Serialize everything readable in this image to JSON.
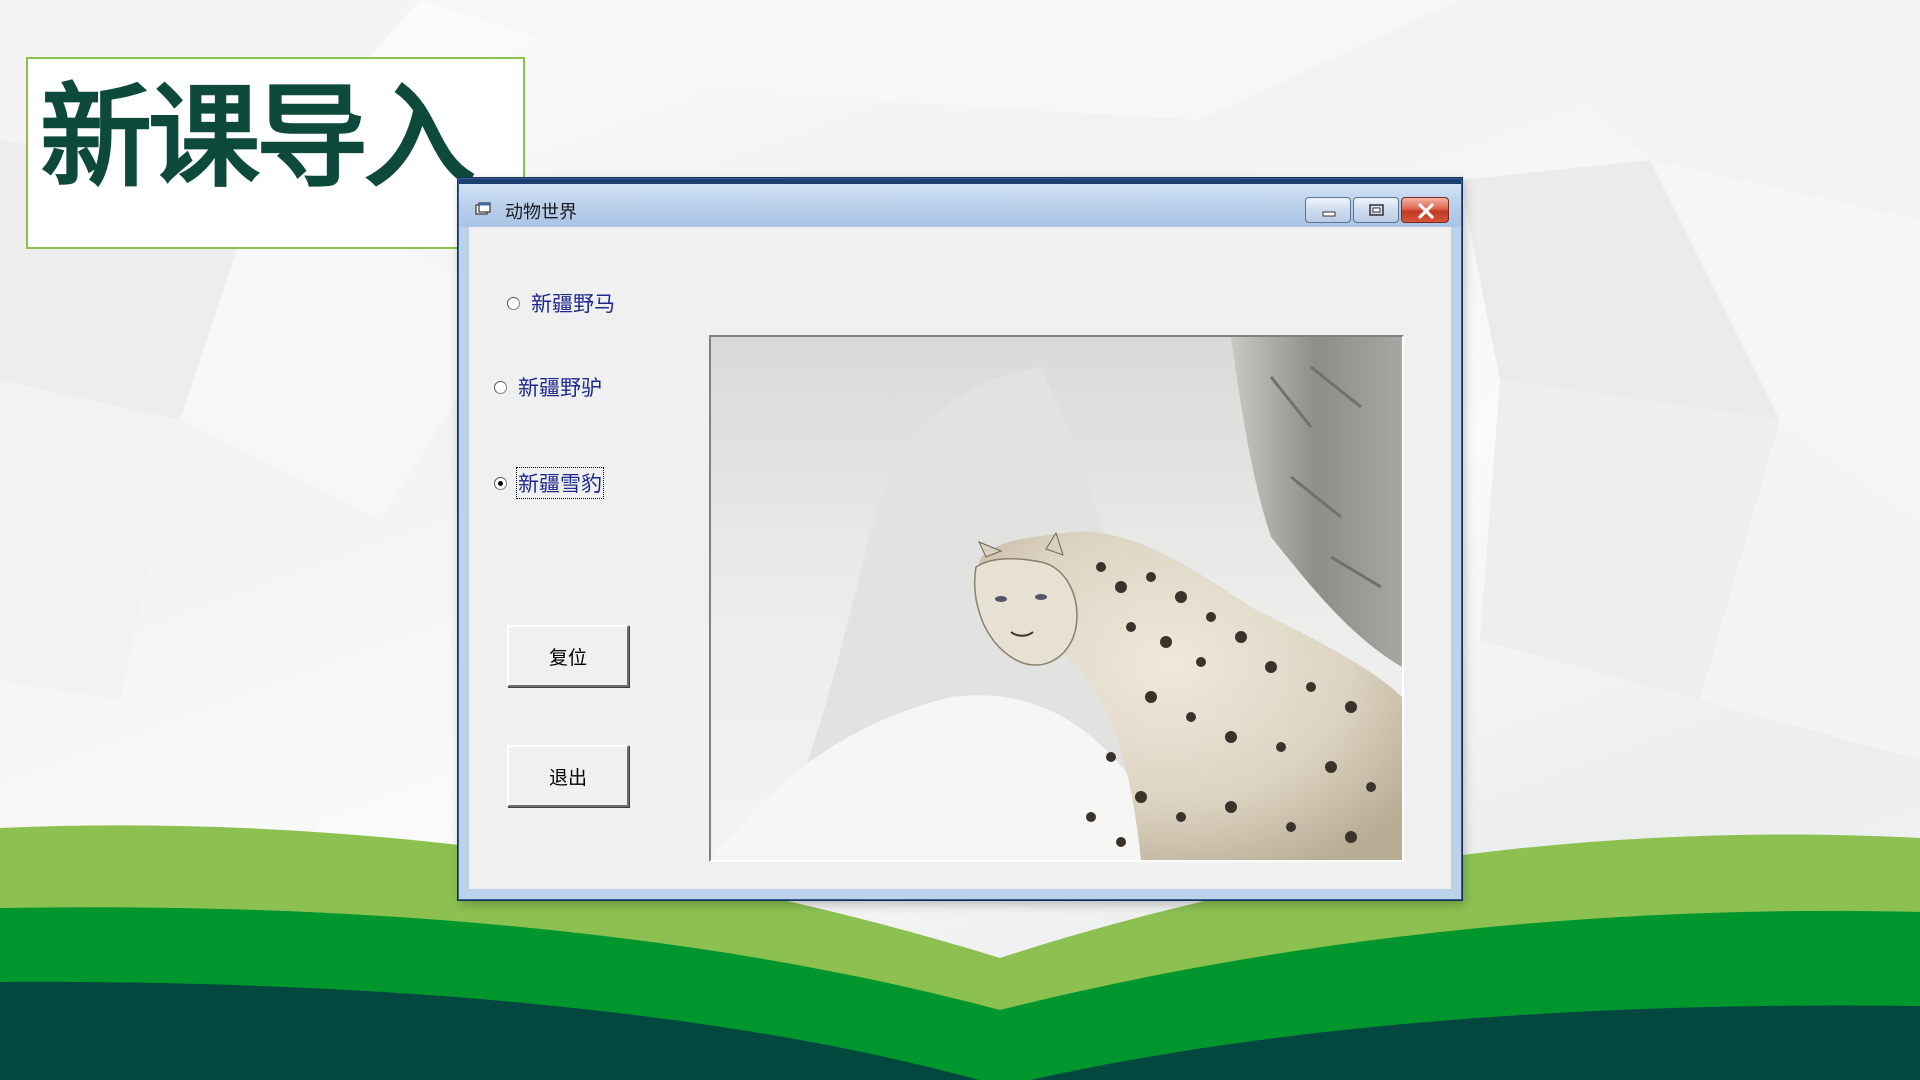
{
  "slide": {
    "title": "新课导入",
    "colors": {
      "title": "#0e4a3c",
      "frame": "#8cc152",
      "band_light": "#8cc152",
      "band_mid": "#00962e",
      "band_dark": "#02483e"
    }
  },
  "window": {
    "title": "动物世界",
    "icons": {
      "app": "form-icon",
      "minimize": "minimize-icon",
      "maximize": "maximize-icon",
      "close": "close-icon"
    }
  },
  "options": [
    {
      "label": "新疆野马",
      "checked": false
    },
    {
      "label": "新疆野驴",
      "checked": false
    },
    {
      "label": "新疆雪豹",
      "checked": true
    }
  ],
  "buttons": {
    "reset": "复位",
    "exit": "退出"
  },
  "picture": {
    "subject": "snow-leopard"
  }
}
